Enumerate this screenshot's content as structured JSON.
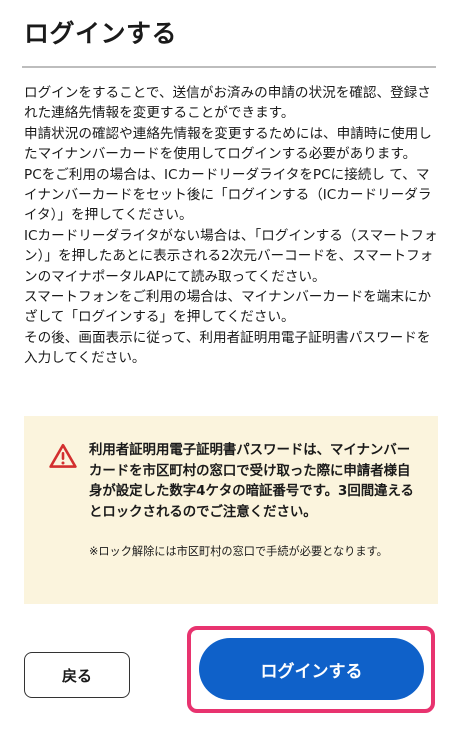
{
  "header": {
    "title": "ログインする"
  },
  "description": {
    "paragraphs": [
      "ログインをすることで、送信がお済みの申請の状況を確認、登録された連絡先情報を変更することができます。",
      "申請状況の確認や連絡先情報を変更するためには、申請時に使用したマイナンバーカードを使用してログインする必要があります。",
      "PCをご利用の場合は、ICカードリーダライタをPCに接続し て、マイナンバーカードをセット後に「ログインする（ICカードリーダライタ）」を押してください。",
      "ICカードリーダライタがない場合は、「ログインする（スマートフォン）」を押したあとに表示される2次元バーコードを、スマートフォンのマイナポータルAPにて読み取ってください。",
      "スマートフォンをご利用の場合は、マイナンバーカードを端末にかざして「ログインする」を押してください。",
      "その後、画面表示に従って、利用者証明用電子証明書パスワードを入力してください。"
    ]
  },
  "notice": {
    "icon": "warning-triangle-icon",
    "main_text": "利用者証明用電子証明書パスワードは、マイナンバーカードを市区町村の窓口で受け取った際に申請者様自身が設定した数字4ケタの暗証番号です。3回間違えるとロックされるのでご注意ください。",
    "note_text": "※ロック解除には市区町村の窓口で手続が必要となります。"
  },
  "actions": {
    "back_label": "戻る",
    "login_label": "ログインする"
  },
  "colors": {
    "primary": "#0f61c9",
    "highlight": "#e8336f",
    "notice_bg": "#fbf4dd",
    "warning": "#d32f2f"
  }
}
